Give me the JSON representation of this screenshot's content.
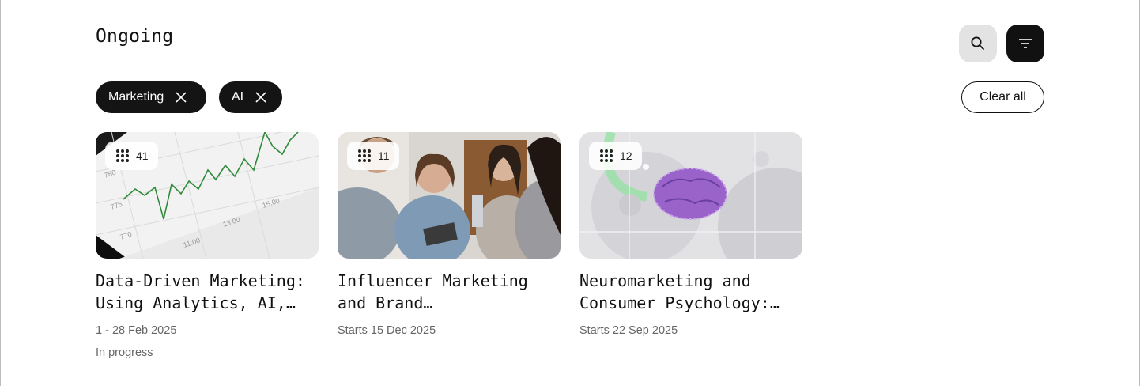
{
  "page": {
    "title": "Ongoing"
  },
  "toolbar": {
    "search_icon": "search-icon",
    "filter_icon": "filter-icon"
  },
  "filters": {
    "chips": [
      {
        "label": "Marketing"
      },
      {
        "label": "AI"
      }
    ],
    "clear_label": "Clear all"
  },
  "courses": [
    {
      "count": "41",
      "title": "Data-Driven Marketing: Using Analytics, AI, and Automation",
      "date": "1 - 28 Feb 2025",
      "status": "In progress",
      "image": "chart-on-laptop-photo"
    },
    {
      "count": "11",
      "title": "Influencer Marketing and Brand Collaborations",
      "date": "Starts 15 Dec 2025",
      "image": "people-meeting-photo"
    },
    {
      "count": "12",
      "title": "Neuromarketing and Consumer Psychology: How the Brain Decides",
      "date": "Starts 22 Sep 2025",
      "image": "brain-render-photo"
    }
  ]
}
